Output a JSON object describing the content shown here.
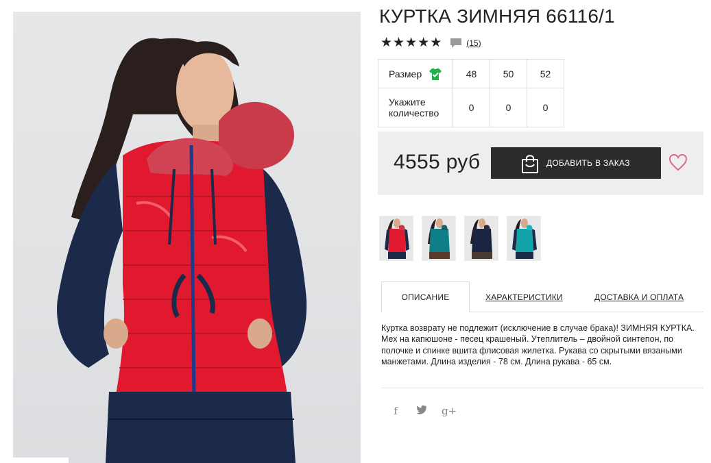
{
  "product": {
    "title": "КУРТКА ЗИМНЯЯ 66116/1",
    "rating": 5,
    "review_count": "(15)"
  },
  "size_table": {
    "size_label": "Размер",
    "sizes": [
      "48",
      "50",
      "52"
    ],
    "quantity_label": "Укажите количество",
    "quantities": [
      "0",
      "0",
      "0"
    ]
  },
  "purchase": {
    "price": "4555 руб",
    "order_button": "ДОБАВИТЬ В ЗАКАЗ"
  },
  "thumbnails": [
    {
      "color": "red"
    },
    {
      "color": "teal"
    },
    {
      "color": "navy"
    },
    {
      "color": "teal-alt"
    }
  ],
  "tabs": [
    {
      "label": "ОПИСАНИЕ",
      "active": true
    },
    {
      "label": "ХАРАКТЕРИСТИКИ",
      "active": false
    },
    {
      "label": "ДОСТАВКА И ОПЛАТА",
      "active": false
    }
  ],
  "description": "Куртка возврату не подлежит (исключение в случае брака)! ЗИМНЯЯ КУРТКА. Мех на капюшоне - песец крашеный. Утеплитель – двойной синтепон, по полочке и спинке вшита флисовая жилетка. Рукава со скрытыми вязаными манжетами. Длина изделия - 78 см. Длина рукава - 65 см.",
  "social": {
    "facebook": "f",
    "twitter": "t",
    "google_plus": "g+"
  },
  "colors": {
    "button_bg": "#2b2b2b",
    "price_box_bg": "#eeeeee",
    "check_green": "#21b04b",
    "heart_pink": "#d9688c",
    "jacket_red": "#e0192f",
    "jacket_navy": "#1b2a4a"
  }
}
